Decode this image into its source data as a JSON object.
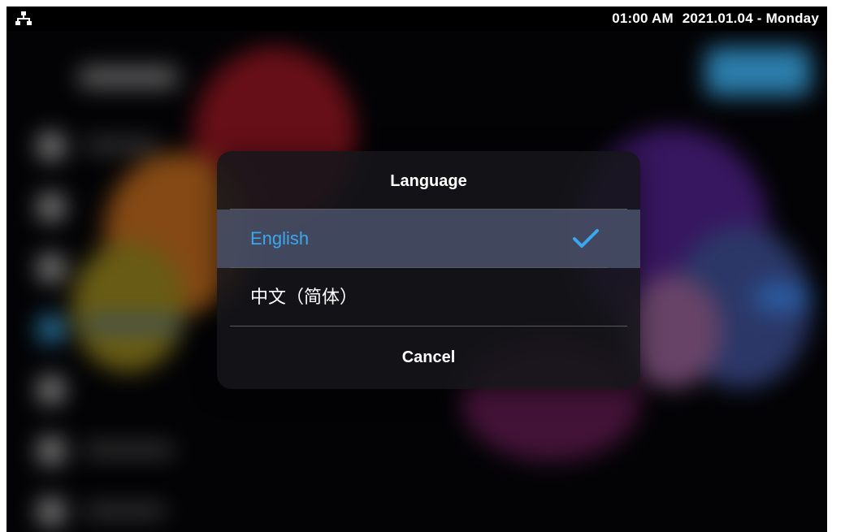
{
  "status_bar": {
    "network_icon": "network-icon",
    "time": "01:00 AM",
    "date": "2021.01.04 - Monday"
  },
  "dialog": {
    "title": "Language",
    "options": [
      {
        "label": "English",
        "selected": true
      },
      {
        "label": "中文（简体）",
        "selected": false
      }
    ],
    "cancel_label": "Cancel",
    "check_icon": "checkmark-icon"
  },
  "colors": {
    "accent": "#3aa8f0",
    "selected_row": "#5a6482",
    "dialog_bg": "#16161a"
  }
}
